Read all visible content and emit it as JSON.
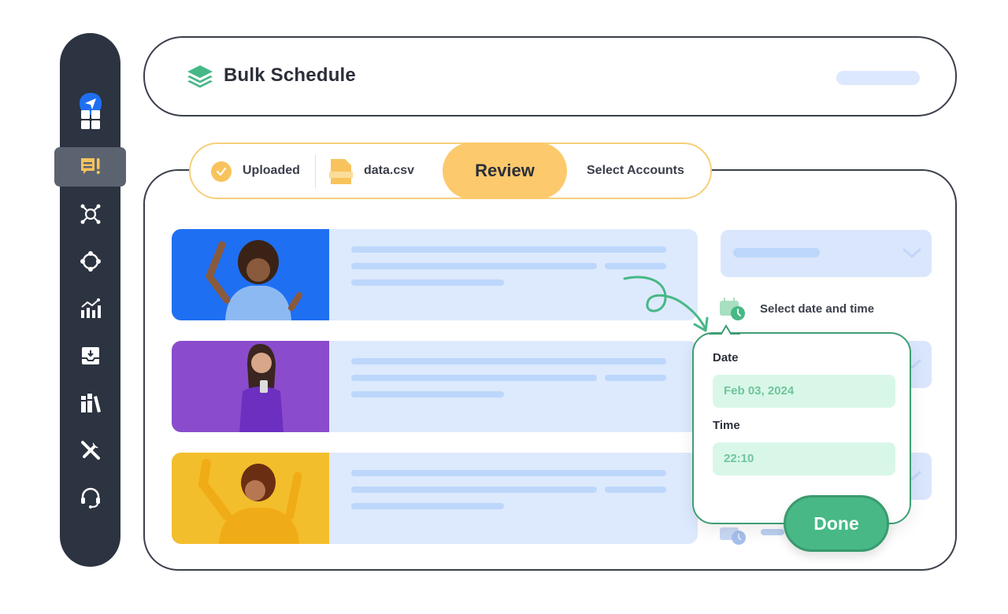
{
  "sidebar": {
    "items": [
      {
        "name": "send-logo-icon",
        "active": false
      },
      {
        "name": "dashboard-icon",
        "active": false
      },
      {
        "name": "publish-icon",
        "active": true
      },
      {
        "name": "network-icon",
        "active": false
      },
      {
        "name": "engage-icon",
        "active": false
      },
      {
        "name": "analytics-icon",
        "active": false
      },
      {
        "name": "inbox-icon",
        "active": false
      },
      {
        "name": "library-icon",
        "active": false
      },
      {
        "name": "tools-icon",
        "active": false
      },
      {
        "name": "support-icon",
        "active": false
      }
    ],
    "accent_color": "#f8c35d",
    "logo_color": "#1f6ff2"
  },
  "header": {
    "title": "Bulk Schedule",
    "icon": "layers-icon",
    "icon_color": "#46b886"
  },
  "steps": {
    "uploaded_label": "Uploaded",
    "file_name": "data.csv",
    "current_label": "Review",
    "next_label": "Select Accounts",
    "accent_color": "#fcc96c"
  },
  "posts": [
    {
      "image": "person-blue-background",
      "image_color": "#1f6ff2"
    },
    {
      "image": "person-purple-background",
      "image_color": "#8a4ccc"
    },
    {
      "image": "person-yellow-background",
      "image_color": "#f3be2c"
    }
  ],
  "schedule": {
    "select_label": "Select date and time",
    "date_label": "Date",
    "date_value": "Feb 03, 2024",
    "time_label": "Time",
    "time_value": "22:10",
    "done_label": "Done",
    "accent_color": "#47b886"
  }
}
